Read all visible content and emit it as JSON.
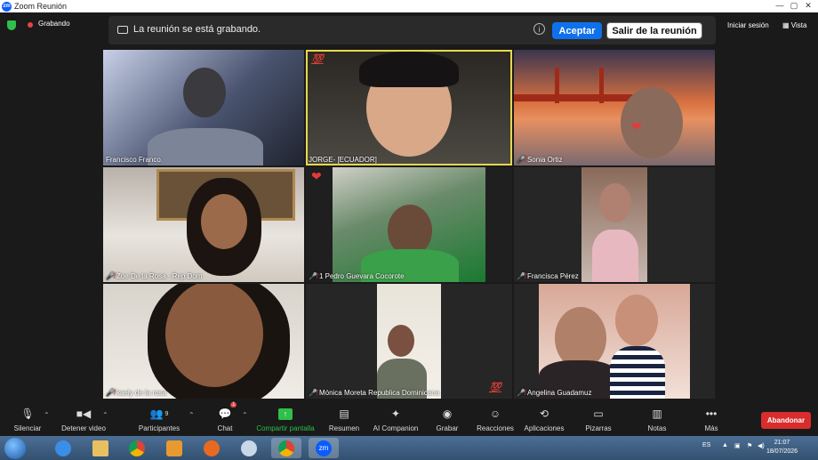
{
  "window": {
    "title": "Zoom Reunión",
    "logo": "zm"
  },
  "topbar": {
    "recording_label": "Grabando",
    "banner_message": "La reunión se está grabando.",
    "accept_label": "Aceptar",
    "leave_meeting_label": "Salir de la reunión",
    "login_label": "Iniciar sesión",
    "view_label": "Vista"
  },
  "participants": [
    {
      "name": "Francisco Franco.",
      "muted": false
    },
    {
      "name": "JORGE- [ECUADOR]",
      "muted": false,
      "active_speaker": true,
      "reaction": "💯"
    },
    {
      "name": "Sonia Ortiz",
      "muted": true,
      "reaction": "❤"
    },
    {
      "name": "Zoe De la Rosa - Rep Dom",
      "muted": true
    },
    {
      "name": "1 Pedro Guevara Cocorote",
      "muted": true,
      "reaction": "❤"
    },
    {
      "name": "Francisca Pérez",
      "muted": true
    },
    {
      "name": "kaely de la rosa",
      "muted": true
    },
    {
      "name": "Mónica Moreta Republica Dominicana",
      "muted": true,
      "reaction": "💯"
    },
    {
      "name": "Angelina Guadamuz",
      "muted": true
    }
  ],
  "toolbar": {
    "mute": "Silenciar",
    "video": "Detener video",
    "participants": "Participantes",
    "participants_count": "9",
    "chat": "Chat",
    "chat_badge": "1",
    "share": "Compartir pantalla",
    "summary": "Resumen",
    "ai": "AI Companion",
    "record": "Grabar",
    "reactions": "Reacciones",
    "apps": "Aplicaciones",
    "whiteboards": "Pizarras",
    "notes": "Notas",
    "more": "Más",
    "end": "Abandonar"
  },
  "taskbar": {
    "language": "ES",
    "time": "21:07",
    "date": "18/07/2026",
    "zoom_label": "zm"
  },
  "colors": {
    "accent_blue": "#0e71eb",
    "end_red": "#d92d2d",
    "share_green": "#2fbf4a",
    "active_border": "#e6d94d"
  }
}
